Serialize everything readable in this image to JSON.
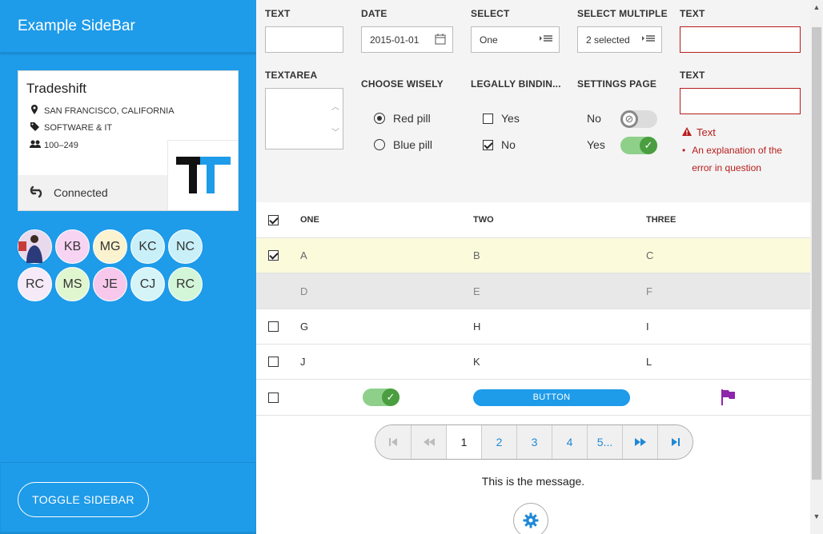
{
  "sidebar": {
    "title": "Example SideBar",
    "card": {
      "name": "Tradeshift",
      "location": "SAN FRANCISCO, CALIFORNIA",
      "industry": "SOFTWARE & IT",
      "size": "100–249",
      "status": "Connected"
    },
    "avatars": [
      {
        "initials": "",
        "color": "#f3d4e6"
      },
      {
        "initials": "KB",
        "color": "#f6d4f2"
      },
      {
        "initials": "MG",
        "color": "#fbf3cf"
      },
      {
        "initials": "KC",
        "color": "#c9f0f9"
      },
      {
        "initials": "NC",
        "color": "#c9f0f9"
      },
      {
        "initials": "RC",
        "color": "#f6eaf8"
      },
      {
        "initials": "MS",
        "color": "#e0f6cf"
      },
      {
        "initials": "JE",
        "color": "#f7c8ec"
      },
      {
        "initials": "CJ",
        "color": "#d5f4f8"
      },
      {
        "initials": "RC",
        "color": "#d3f5d8"
      }
    ],
    "toggle_label": "TOGGLE SIDEBAR"
  },
  "form": {
    "text_label": "TEXT",
    "date_label": "DATE",
    "date_value": "2015-01-01",
    "select_label": "SELECT",
    "select_value": "One",
    "select_multiple_label": "SELECT MULTIPLE",
    "select_multiple_value": "2 selected",
    "text_error_label": "TEXT",
    "textarea_label": "TEXTAREA",
    "choose_label": "CHOOSE WISELY",
    "radio_red": "Red pill",
    "radio_blue": "Blue pill",
    "legal_label": "LEGALLY BINDIN...",
    "check_yes": "Yes",
    "check_no": "No",
    "settings_label": "SETTINGS PAGE",
    "setting_no": "No",
    "setting_yes": "Yes",
    "text2_label": "TEXT",
    "error_title": "Text",
    "error_item": "An explanation of the error in question"
  },
  "table": {
    "headers": [
      "ONE",
      "TWO",
      "THREE"
    ],
    "rows": [
      [
        "A",
        "B",
        "C"
      ],
      [
        "D",
        "E",
        "F"
      ],
      [
        "G",
        "H",
        "I"
      ],
      [
        "J",
        "K",
        "L"
      ]
    ],
    "button_label": "BUTTON"
  },
  "pager": {
    "pages": [
      "1",
      "2",
      "3",
      "4",
      "5..."
    ],
    "current": "1"
  },
  "message": "This is the message.",
  "colors": {
    "accent": "#1e9be9",
    "error": "#b71c1c",
    "selected_row": "#fbfbdc",
    "flag": "#8e24aa"
  }
}
